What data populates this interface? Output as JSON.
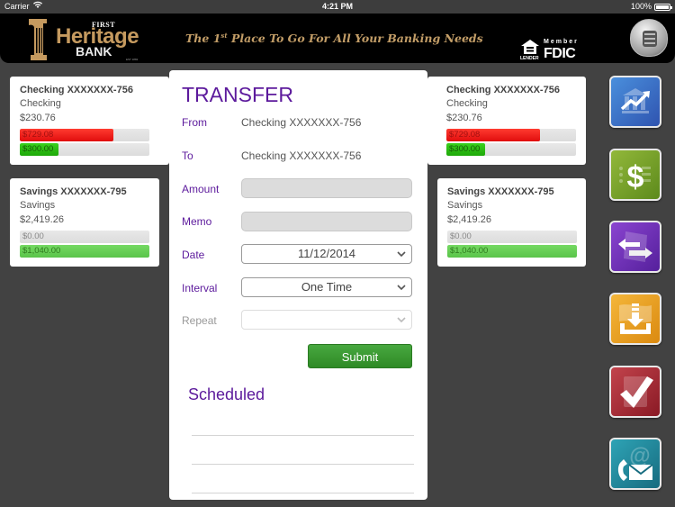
{
  "status_bar": {
    "carrier": "Carrier",
    "wifi_icon": "wifi-icon",
    "time": "4:21 PM",
    "battery": "100%"
  },
  "banner": {
    "logo_first": "FIRST",
    "logo_heritage": "Heritage",
    "logo_bank": "BANK",
    "logo_est": "EST 1882",
    "tagline_pre": "The 1",
    "tagline_sup": "st",
    "tagline_post": " Place To Go For All Your Banking Needs",
    "ehl_label": "LENDER",
    "fdic_member": "Member",
    "fdic": "FDIC",
    "lock_icon": "lock-icon"
  },
  "left_accounts": [
    {
      "name": "Checking XXXXXXX-756",
      "type": "Checking",
      "balance": "$230.76",
      "bars": [
        {
          "label": "$729.08",
          "fill": 0.72,
          "color": "#e81212"
        },
        {
          "label": "$300.00",
          "fill": 0.3,
          "color": "#22b40f"
        }
      ]
    },
    {
      "name": "Savings XXXXXXX-795",
      "type": "Savings",
      "balance": "$2,419.26",
      "bars": [
        {
          "label": "$0.00",
          "fill": 0,
          "color": "#dcdcdc"
        },
        {
          "label": "$1,040.00",
          "fill": 1.0,
          "color": "#66cf54"
        }
      ]
    }
  ],
  "right_accounts": [
    {
      "name": "Checking XXXXXXX-756",
      "type": "Checking",
      "balance": "$230.76",
      "bars": [
        {
          "label": "$729.08",
          "fill": 0.72,
          "color": "#e81212"
        },
        {
          "label": "$300.00",
          "fill": 0.3,
          "color": "#22b40f"
        }
      ]
    },
    {
      "name": "Savings XXXXXXX-795",
      "type": "Savings",
      "balance": "$2,419.26",
      "bars": [
        {
          "label": "$0.00",
          "fill": 0,
          "color": "#dcdcdc"
        },
        {
          "label": "$1,040.00",
          "fill": 1.0,
          "color": "#66cf54"
        }
      ]
    }
  ],
  "transfer": {
    "title": "TRANSFER",
    "from_label": "From",
    "from_value": "Checking XXXXXXX-756",
    "to_label": "To",
    "to_value": "Checking XXXXXXX-756",
    "amount_label": "Amount",
    "amount_value": "",
    "memo_label": "Memo",
    "memo_value": "",
    "date_label": "Date",
    "date_value": "11/12/2014",
    "interval_label": "Interval",
    "interval_value": "One Time",
    "repeat_label": "Repeat",
    "repeat_value": "",
    "submit_label": "Submit",
    "scheduled_title": "Scheduled"
  },
  "nav": [
    {
      "name": "accounts",
      "icon": "bank-chart-icon",
      "color": "#3a6fc4"
    },
    {
      "name": "bill-pay",
      "icon": "dollar-icon",
      "color": "#7aa22a"
    },
    {
      "name": "transfer",
      "icon": "transfer-arrows-icon",
      "color": "#6a2bb0"
    },
    {
      "name": "deposit",
      "icon": "deposit-download-icon",
      "color": "#e39a17"
    },
    {
      "name": "approvals",
      "icon": "checkmark-icon",
      "color": "#a3242e"
    },
    {
      "name": "contact",
      "icon": "phone-mail-icon",
      "color": "#1f8fa0"
    }
  ]
}
